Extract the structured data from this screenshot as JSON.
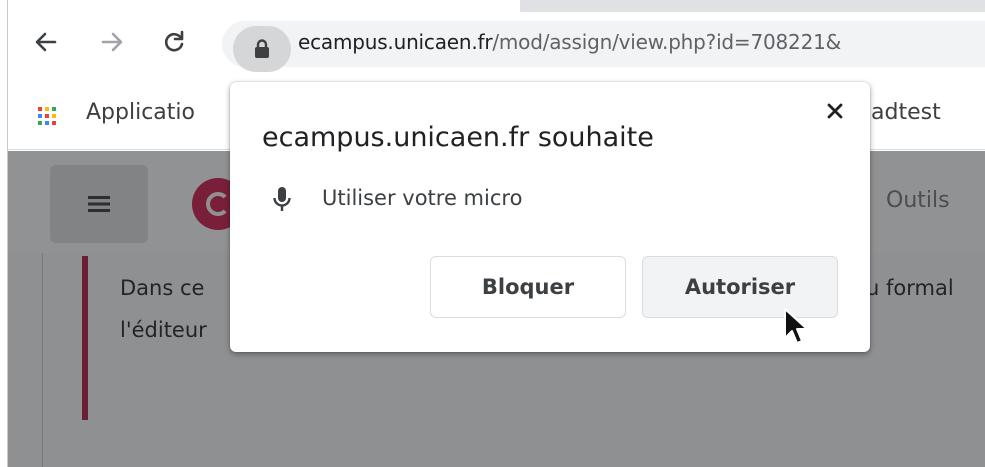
{
  "browser": {
    "url_host": "ecampus.unicaen.fr",
    "url_path": "/mod/assign/view.php?id=708221&",
    "back_icon": "arrow-left-icon",
    "forward_icon": "arrow-right-icon",
    "reload_icon": "reload-icon",
    "lock_icon": "lock-icon"
  },
  "bookmarks": {
    "apps_label": "Applicatio",
    "right_label": "adtest"
  },
  "page": {
    "nav_right": "Outils",
    "text_line_1": "Dans ce",
    "text_line_2": "l'éditeur",
    "text_right": "u formal"
  },
  "popup": {
    "title": "ecampus.unicaen.fr souhaite",
    "permission": "Utiliser votre micro",
    "block_label": "Bloquer",
    "allow_label": "Autoriser",
    "close_glyph": "✕"
  },
  "colors": {
    "accent_brand": "#7a1f3a",
    "page_dim": "#8f9092"
  }
}
